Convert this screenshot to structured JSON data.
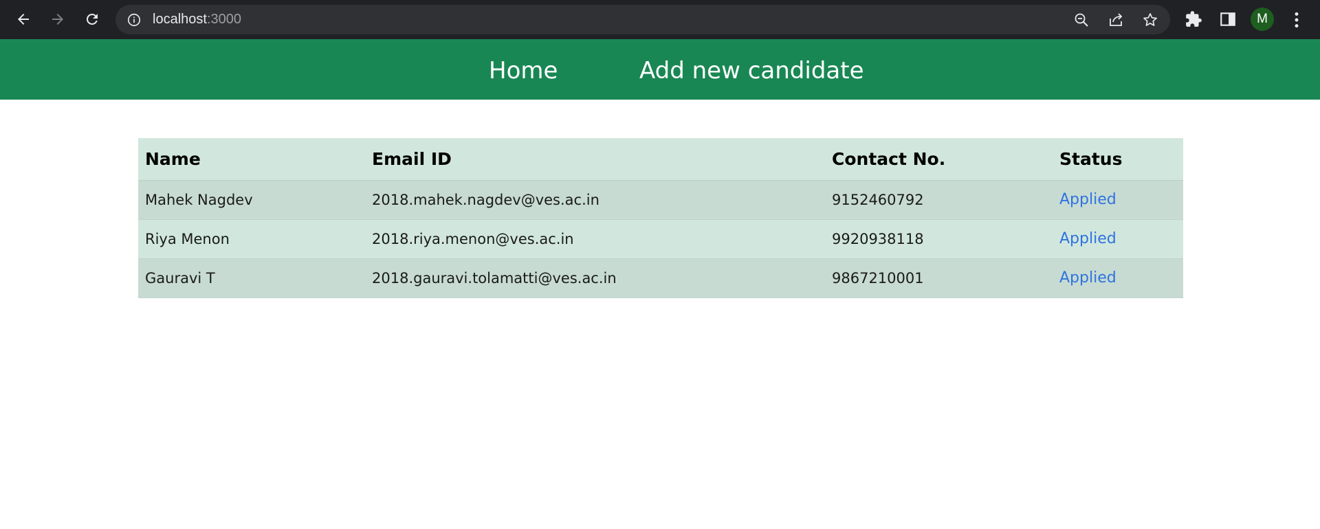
{
  "browser": {
    "url_host": "localhost",
    "url_port": ":3000",
    "profile_initial": "M"
  },
  "navbar": {
    "links": [
      "Home",
      "Add new candidate"
    ],
    "color": "#198754"
  },
  "table": {
    "headers": [
      "Name",
      "Email ID",
      "Contact No.",
      "Status"
    ],
    "rows": [
      {
        "name": "Mahek Nagdev",
        "email": "2018.mahek.nagdev@ves.ac.in",
        "contact": "9152460792",
        "status": "Applied"
      },
      {
        "name": "Riya Menon",
        "email": "2018.riya.menon@ves.ac.in",
        "contact": "9920938118",
        "status": "Applied"
      },
      {
        "name": "Gauravi T",
        "email": "2018.gauravi.tolamatti@ves.ac.in",
        "contact": "9867210001",
        "status": "Applied"
      }
    ]
  }
}
